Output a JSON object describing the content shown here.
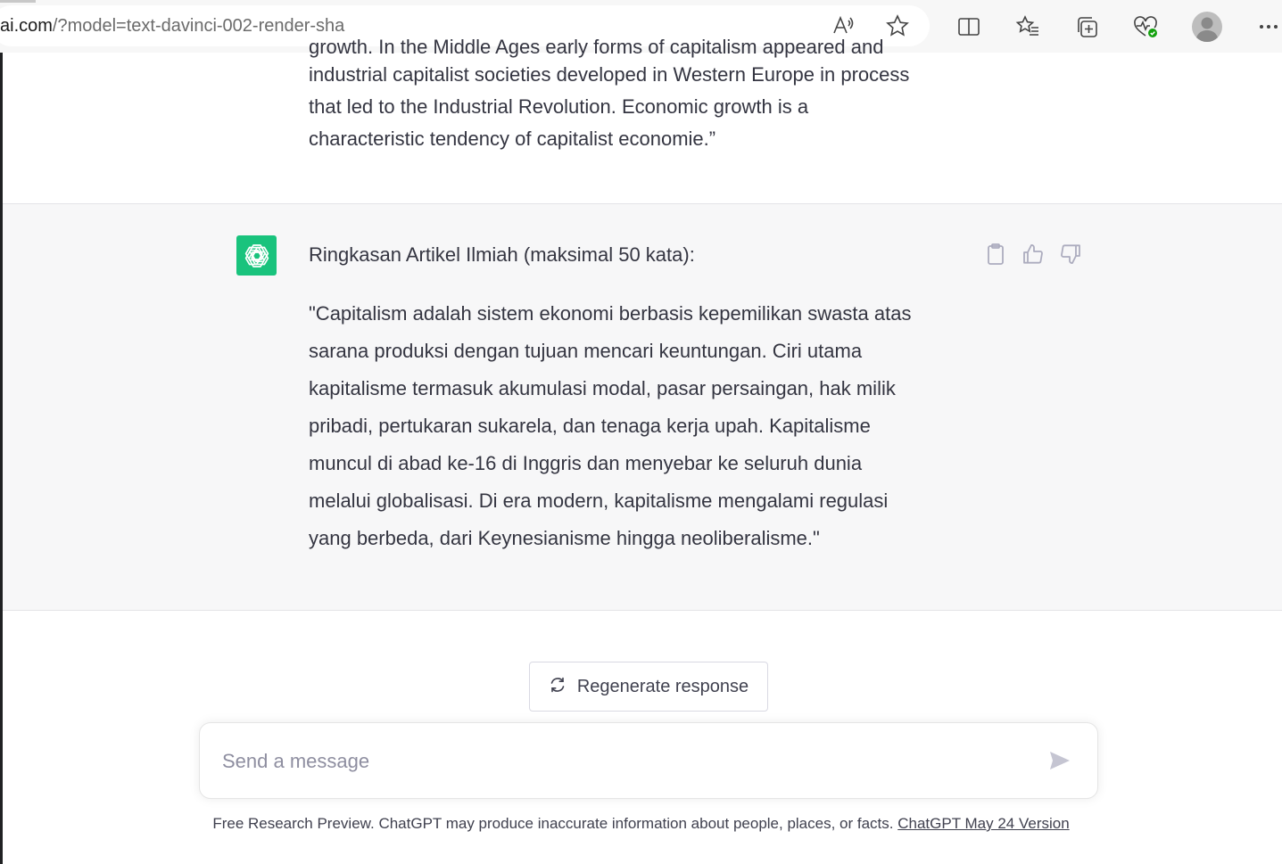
{
  "browser": {
    "url_main": "ai.com",
    "url_path": "/?model=text-davinci-002-render-sha",
    "icons": [
      "read-aloud-icon",
      "favorite-star-icon",
      "split-screen-icon",
      "favorites-list-icon",
      "collections-icon",
      "browser-essentials-icon",
      "profile-avatar",
      "more-menu-icon"
    ]
  },
  "conversation": {
    "user_message_cut_line": "growth. In the Middle Ages early forms of capitalism appeared and",
    "user_message_lines": [
      "industrial capitalist societies developed in Western Europe in process",
      "that led to the Industrial Revolution. Economic growth is a",
      "characteristic tendency of capitalist economie.”"
    ],
    "assistant": {
      "title": "Ringkasan Artikel Ilmiah (maksimal 50 kata):",
      "body_lines": [
        "\"Capitalism adalah sistem ekonomi berbasis kepemilikan swasta atas",
        "sarana produksi dengan tujuan mencari keuntungan. Ciri utama",
        "kapitalisme termasuk akumulasi modal, pasar persaingan, hak milik",
        "pribadi, pertukaran sukarela, dan tenaga kerja upah. Kapitalisme",
        "muncul di abad ke-16 di Inggris dan menyebar ke seluruh dunia",
        "melalui globalisasi. Di era modern, kapitalisme mengalami regulasi",
        "yang berbeda, dari Keynesianisme hingga neoliberalisme.\""
      ],
      "action_icons": [
        "copy-icon",
        "thumbs-up-icon",
        "thumbs-down-icon"
      ]
    }
  },
  "composer": {
    "regenerate_label": "Regenerate response",
    "placeholder": "Send a message",
    "value": ""
  },
  "footer": {
    "note": "Free Research Preview. ChatGPT may produce inaccurate information about people, places, or facts. ",
    "version_link": "ChatGPT May 24 Version"
  },
  "colors": {
    "brand_green": "#19c37d",
    "assistant_bg": "#f7f7f8",
    "text": "#343541"
  }
}
